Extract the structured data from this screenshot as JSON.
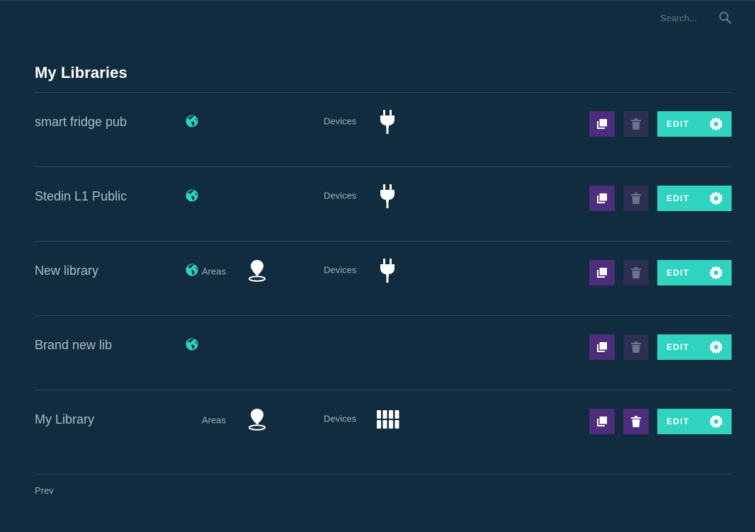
{
  "search": {
    "placeholder": "Search..."
  },
  "page_title": "My Libraries",
  "libraries": [
    {
      "name": "smart fridge pub",
      "public": true,
      "areas_label": "",
      "devices_label": "Devices",
      "device_icon": "plug-icon",
      "delete_active": false
    },
    {
      "name": "Stedin L1 Public",
      "public": true,
      "areas_label": "",
      "devices_label": "Devices",
      "device_icon": "plug-icon",
      "delete_active": false
    },
    {
      "name": "New library",
      "public": true,
      "areas_label": "Areas",
      "devices_label": "Devices",
      "device_icon": "plug-icon",
      "delete_active": false
    },
    {
      "name": "Brand new lib",
      "public": true,
      "areas_label": "",
      "devices_label": "",
      "device_icon": "",
      "delete_active": false
    },
    {
      "name": "My Library",
      "public": false,
      "areas_label": "Areas",
      "devices_label": "Devices",
      "device_icon": "grid-icon",
      "delete_active": true
    }
  ],
  "actions": {
    "edit_label": "EDIT"
  },
  "pagination": {
    "prev_label": "Prev"
  },
  "colors": {
    "background": "#102c3e",
    "accent_teal": "#2fd3c0",
    "copy_purple": "#4e2d7c",
    "delete_muted": "#2c2e52",
    "globe_teal": "#2fd3c0"
  }
}
